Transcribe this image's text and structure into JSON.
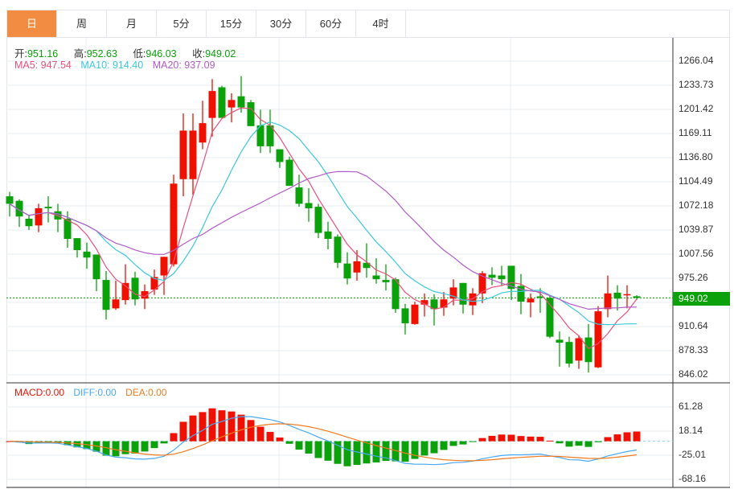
{
  "tabs": [
    {
      "label": "日",
      "active": true
    },
    {
      "label": "周"
    },
    {
      "label": "月"
    },
    {
      "label": "5分"
    },
    {
      "label": "15分"
    },
    {
      "label": "30分"
    },
    {
      "label": "60分"
    },
    {
      "label": "4时"
    }
  ],
  "ohlc_info": {
    "open_label": "开:",
    "open": "951.16",
    "high_label": "高:",
    "high": "952.63",
    "low_label": "低:",
    "low": "946.03",
    "close_label": "收:",
    "close": "949.02"
  },
  "ma_info": {
    "ma5": "MA5: 947.54",
    "ma10": "MA10: 914.40",
    "ma20": "MA20: 937.09"
  },
  "macd_info": {
    "macd": "MACD:0.00",
    "diff": "DIFF:0.00",
    "dea": "DEA:0.00"
  },
  "current_price": "949.02",
  "colors": {
    "up": "#ee1100",
    "down": "#0aa10a",
    "ma5": "#e8507a",
    "ma10": "#3cc8dc",
    "ma20": "#b25cc8",
    "diff": "#4aa8f0",
    "dea": "#f07a20",
    "accent": "#f28c42"
  },
  "chart_data": {
    "type": "candlestick",
    "price_axis_labels": [
      "1266.04",
      "1233.73",
      "1201.42",
      "1169.11",
      "1136.80",
      "1104.49",
      "1072.18",
      "1039.87",
      "1007.56",
      "975.26",
      "910.64",
      "878.33",
      "846.02"
    ],
    "price_range": [
      846.02,
      1266.04
    ],
    "macd_axis_labels": [
      "61.28",
      "18.14",
      "-25.01",
      "-68.16"
    ],
    "macd_range": [
      -68.16,
      61.28
    ],
    "ohlc": [
      [
        1085,
        1091,
        1058,
        1075
      ],
      [
        1079,
        1081,
        1044,
        1058
      ],
      [
        1055,
        1060,
        1040,
        1045
      ],
      [
        1046,
        1075,
        1037,
        1069
      ],
      [
        1071,
        1085,
        1050,
        1069
      ],
      [
        1065,
        1075,
        1037,
        1054
      ],
      [
        1055,
        1065,
        1016,
        1028
      ],
      [
        1029,
        1029,
        1003,
        1013
      ],
      [
        1011,
        1023,
        988,
        1003
      ],
      [
        1007,
        1007,
        958,
        974
      ],
      [
        973,
        985,
        920,
        933
      ],
      [
        935,
        972,
        933,
        947
      ],
      [
        946,
        994,
        940,
        969
      ],
      [
        976,
        984,
        939,
        947
      ],
      [
        948,
        967,
        934,
        958
      ],
      [
        960,
        987,
        953,
        977
      ],
      [
        979,
        1004,
        953,
        1004
      ],
      [
        994,
        1114,
        991,
        1102
      ],
      [
        1108,
        1196,
        1085,
        1173
      ],
      [
        1108,
        1196,
        1087,
        1173
      ],
      [
        1157,
        1213,
        1148,
        1183
      ],
      [
        1190,
        1242,
        1165,
        1226
      ],
      [
        1231,
        1233,
        1190,
        1190
      ],
      [
        1204,
        1223,
        1184,
        1214
      ],
      [
        1219,
        1246,
        1197,
        1204
      ],
      [
        1211,
        1214,
        1179,
        1179
      ],
      [
        1180,
        1201,
        1143,
        1152
      ],
      [
        1180,
        1201,
        1143,
        1152
      ],
      [
        1148,
        1148,
        1123,
        1131
      ],
      [
        1134,
        1138,
        1099,
        1099
      ],
      [
        1097,
        1114,
        1071,
        1075
      ],
      [
        1076,
        1096,
        1051,
        1069
      ],
      [
        1071,
        1075,
        1029,
        1036
      ],
      [
        1038,
        1051,
        1014,
        1028
      ],
      [
        1031,
        1034,
        989,
        996
      ],
      [
        995,
        1010,
        967,
        975
      ],
      [
        983,
        1013,
        972,
        998
      ],
      [
        996,
        1022,
        976,
        989
      ],
      [
        979,
        1002,
        968,
        974
      ],
      [
        973,
        994,
        959,
        970
      ],
      [
        974,
        976,
        929,
        934
      ],
      [
        935,
        941,
        900,
        915
      ],
      [
        914,
        944,
        913,
        940
      ],
      [
        940,
        955,
        924,
        946
      ],
      [
        947,
        954,
        912,
        934
      ],
      [
        936,
        957,
        925,
        947
      ],
      [
        948,
        974,
        939,
        963
      ],
      [
        969,
        969,
        928,
        940
      ],
      [
        939,
        962,
        926,
        955
      ],
      [
        955,
        985,
        942,
        982
      ],
      [
        980,
        990,
        966,
        976
      ],
      [
        979,
        992,
        966,
        974
      ],
      [
        992,
        992,
        946,
        961
      ],
      [
        965,
        981,
        927,
        944
      ],
      [
        943,
        955,
        923,
        948
      ],
      [
        951,
        962,
        929,
        949
      ],
      [
        949,
        952,
        895,
        897
      ],
      [
        893,
        904,
        857,
        889
      ],
      [
        890,
        897,
        856,
        861
      ],
      [
        865,
        899,
        854,
        895
      ],
      [
        896,
        914,
        849,
        863
      ],
      [
        856,
        938,
        855,
        931
      ],
      [
        934,
        979,
        923,
        955
      ],
      [
        956,
        966,
        932,
        948
      ],
      [
        953,
        966,
        935,
        954
      ],
      [
        951.16,
        952.63,
        946.03,
        949.02
      ]
    ]
  }
}
